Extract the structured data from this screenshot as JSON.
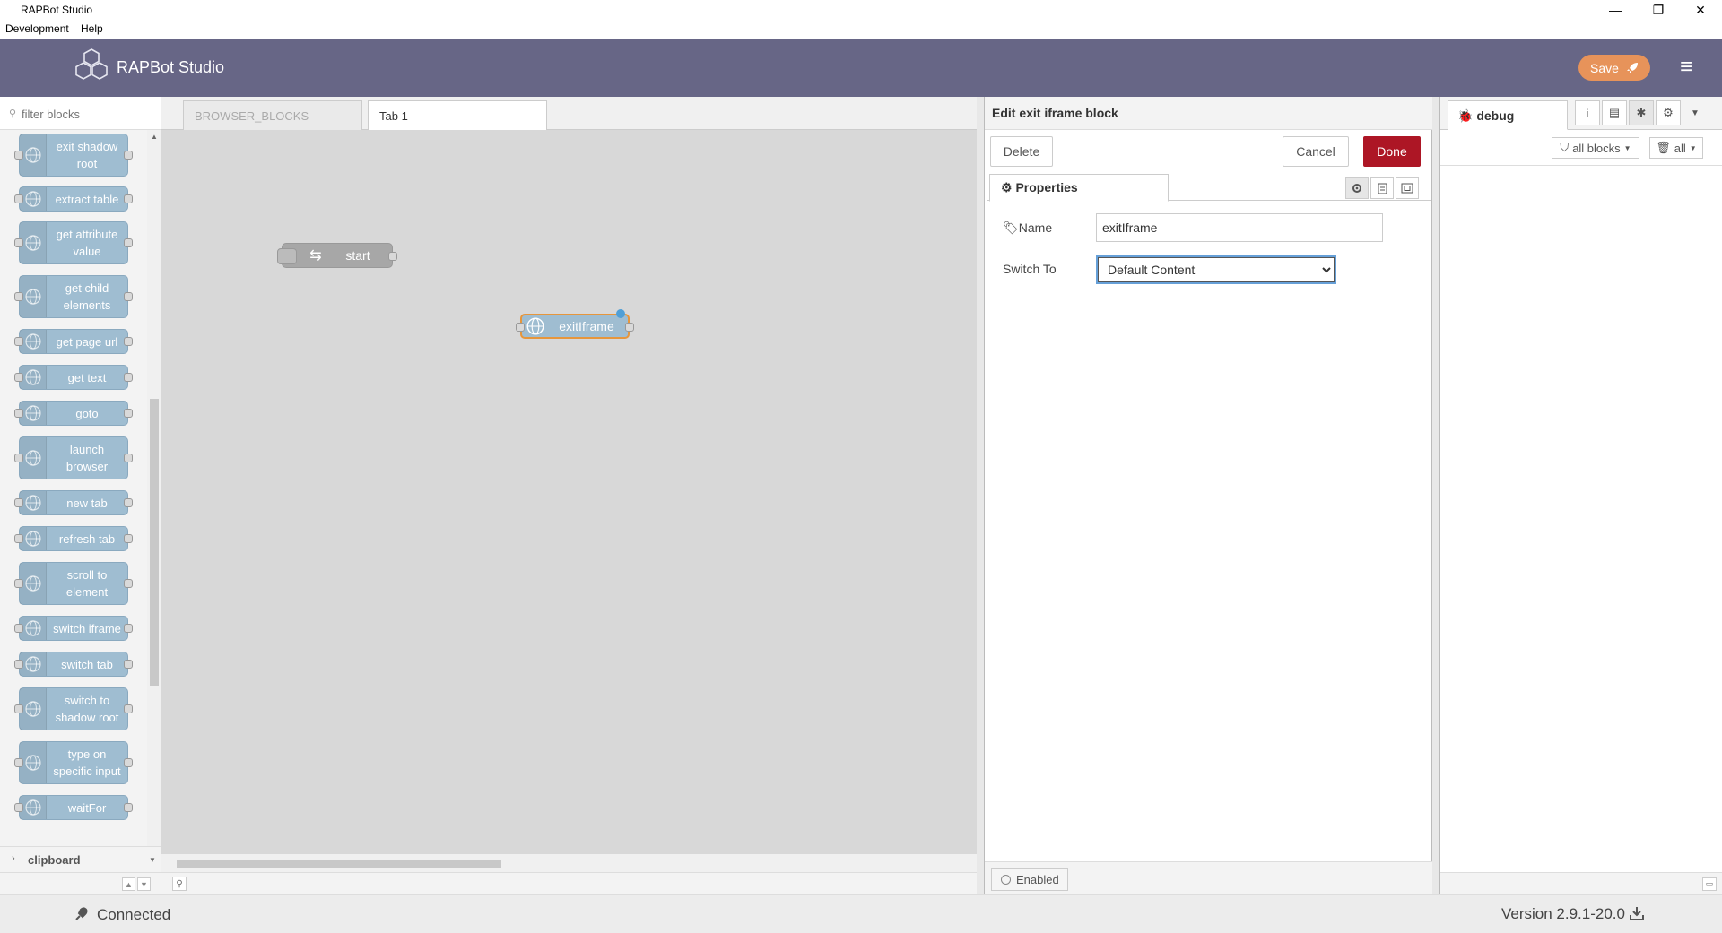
{
  "window": {
    "title": "RAPBot Studio",
    "minimize": "—",
    "restore": "❐",
    "close": "✕"
  },
  "menu": [
    "Development",
    "Help"
  ],
  "header": {
    "brand": "RAPBot Studio",
    "save_label": "Save",
    "colors": {
      "header_bg": "#676686",
      "save_bg": "#e7935a"
    }
  },
  "palette": {
    "filter_placeholder": "filter blocks",
    "items": [
      "exit shadow root",
      "extract table",
      "get attribute value",
      "get child elements",
      "get page url",
      "get text",
      "goto",
      "launch browser",
      "new tab",
      "refresh tab",
      "scroll to element",
      "switch iframe",
      "switch tab",
      "switch to shadow root",
      "type on specific input",
      "waitFor"
    ],
    "category": "clipboard"
  },
  "workspace": {
    "tabs": [
      "BROWSER_BLOCKS",
      "Tab 1"
    ],
    "nodes": [
      {
        "label": "start"
      },
      {
        "label": "exitIframe"
      }
    ]
  },
  "editor": {
    "title": "Edit exit iframe block",
    "delete_label": "Delete",
    "cancel_label": "Cancel",
    "done_label": "Done",
    "tab_label": "Properties",
    "name_label": "Name",
    "name_value": "exitIframe",
    "switch_label": "Switch To",
    "switch_value": "Default Content",
    "enabled_label": "Enabled",
    "colors": {
      "done_bg": "#ad1625"
    }
  },
  "sidebar": {
    "tab_label": "debug",
    "filter_label": "all blocks",
    "clear_label": "all"
  },
  "status": {
    "connection": "Connected",
    "version": "Version 2.9.1-20.0"
  }
}
